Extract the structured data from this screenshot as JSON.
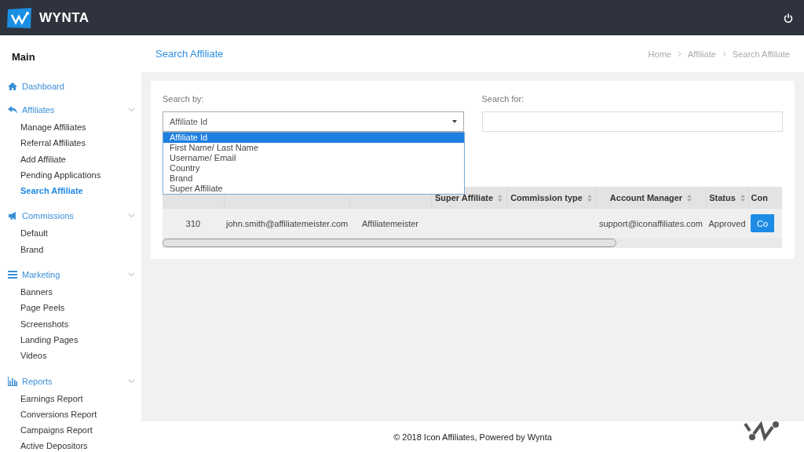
{
  "topbar": {
    "brand": "WYNTA"
  },
  "sidebar": {
    "title": "Main",
    "sections": [
      {
        "kind": "home",
        "label": "Dashboard"
      },
      {
        "kind": "reply",
        "label": "Affiliates",
        "expanded": true,
        "items": [
          {
            "label": "Manage Affiliates",
            "selected": false
          },
          {
            "label": "Referral Affiliates",
            "selected": false
          },
          {
            "label": "Add Affiliate",
            "selected": false
          },
          {
            "label": "Pending Applications",
            "selected": false
          },
          {
            "label": "Search Affiliate",
            "selected": true
          }
        ]
      },
      {
        "kind": "megaphone",
        "label": "Commissions",
        "expanded": true,
        "items": [
          {
            "label": "Default",
            "selected": false
          },
          {
            "label": "Brand",
            "selected": false
          }
        ]
      },
      {
        "kind": "bars",
        "label": "Marketing",
        "expanded": true,
        "items": [
          {
            "label": "Banners",
            "selected": false
          },
          {
            "label": "Page Peels",
            "selected": false
          },
          {
            "label": "Screenshots",
            "selected": false
          },
          {
            "label": "Landing Pages",
            "selected": false
          },
          {
            "label": "Videos",
            "selected": false
          }
        ]
      },
      {
        "kind": "chart",
        "label": "Reports",
        "expanded": true,
        "items": [
          {
            "label": "Earnings Report",
            "selected": false
          },
          {
            "label": "Conversions Report",
            "selected": false
          },
          {
            "label": "Campaigns Report",
            "selected": false
          },
          {
            "label": "Active Depositors",
            "selected": false
          }
        ]
      }
    ]
  },
  "page_header": {
    "title": "Search Affiliate",
    "breadcrumb": [
      "Home",
      "Affiliate",
      "Search Affiliate"
    ]
  },
  "search": {
    "by_label": "Search by:",
    "by_value": "Affiliate Id",
    "for_label": "Search for:",
    "options": [
      {
        "label": "Affiliate Id",
        "selected": true
      },
      {
        "label": "First Name/ Last Name",
        "selected": false
      },
      {
        "label": "Username/ Email",
        "selected": false
      },
      {
        "label": "Country",
        "selected": false
      },
      {
        "label": "Brand",
        "selected": false
      },
      {
        "label": "Super Affiliate",
        "selected": false
      }
    ]
  },
  "table": {
    "columns": [
      {
        "kind": "covered"
      },
      {
        "kind": "covered"
      },
      {
        "kind": "covered"
      },
      {
        "kind": "text",
        "label": "Super Affiliate"
      },
      {
        "kind": "text",
        "label": "Commission type"
      },
      {
        "kind": "text",
        "label": "Account Manager"
      },
      {
        "kind": "text",
        "label": "Status"
      },
      {
        "kind": "cut",
        "label": "Con"
      }
    ],
    "rows": [
      {
        "cells": [
          "310",
          "john.smith@affiliatemeister.com",
          "Affiliatemeister",
          "",
          "",
          "support@iconaffiliates.com",
          "Approved"
        ],
        "button": "Co"
      }
    ]
  },
  "footer": "© 2018 Icon Affiliates, Powered by Wynta"
}
